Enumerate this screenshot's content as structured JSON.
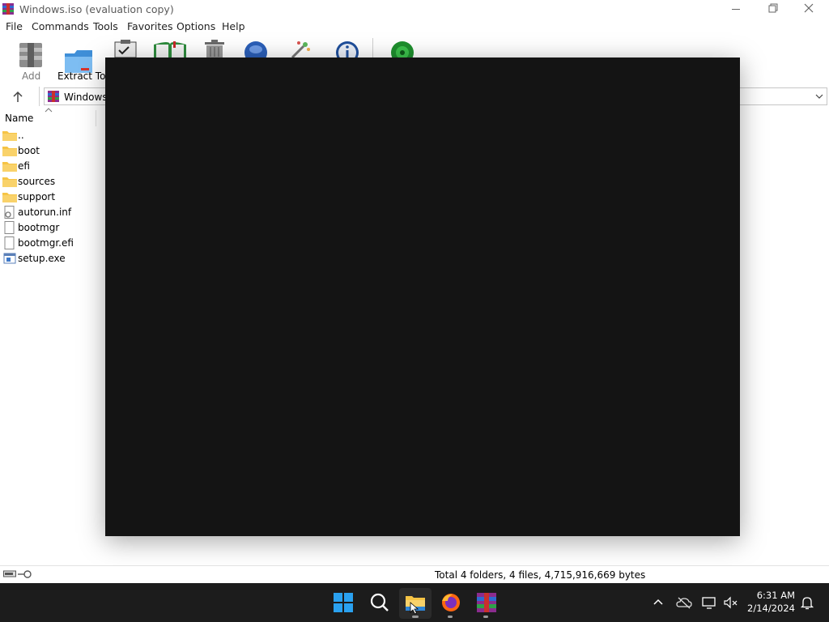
{
  "window": {
    "title": "Windows.iso (evaluation copy)"
  },
  "menu": [
    "File",
    "Commands",
    "Tools",
    "Favorites",
    "Options",
    "Help"
  ],
  "toolbar": {
    "add_label": "Add",
    "extract_label": "Extract To"
  },
  "address": {
    "path": "Windows."
  },
  "list": {
    "column_name": "Name",
    "items": [
      {
        "name": "..",
        "icon": "folder-up-icon"
      },
      {
        "name": "boot",
        "icon": "folder-icon"
      },
      {
        "name": "efi",
        "icon": "folder-icon"
      },
      {
        "name": "sources",
        "icon": "folder-icon"
      },
      {
        "name": "support",
        "icon": "folder-icon"
      },
      {
        "name": "autorun.inf",
        "icon": "settings-file-icon"
      },
      {
        "name": "bootmgr",
        "icon": "file-icon"
      },
      {
        "name": "bootmgr.efi",
        "icon": "file-icon"
      },
      {
        "name": "setup.exe",
        "icon": "exe-icon"
      }
    ]
  },
  "status": {
    "summary": "Total 4 folders, 4 files, 4,715,916,669 bytes"
  },
  "taskbar": {
    "time": "6:31 AM",
    "date": "2/14/2024"
  },
  "colors": {
    "overlay": "#141414",
    "taskbar": "#1c1c1c",
    "folder": "#f6c445",
    "accent": "#0078d4"
  }
}
